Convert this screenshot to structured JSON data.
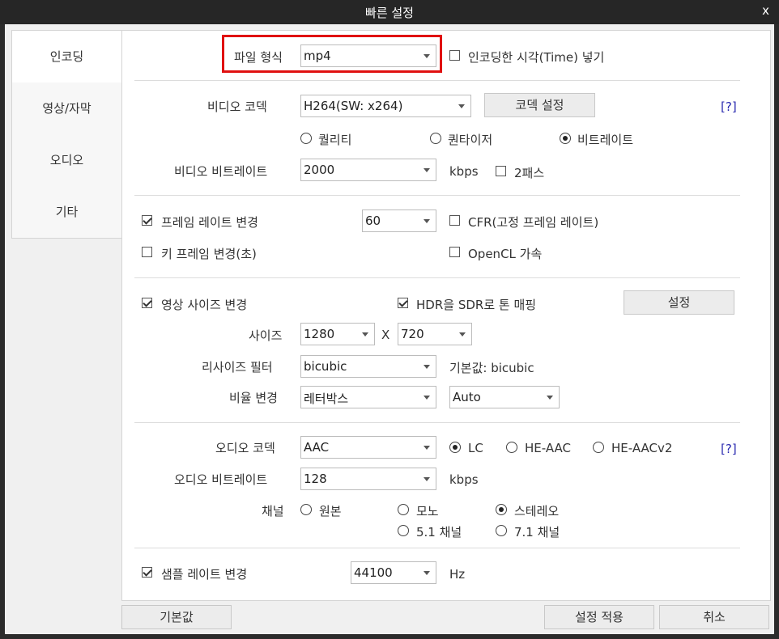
{
  "window": {
    "title": "빠른 설정",
    "close_label": "x"
  },
  "sidebar": {
    "items": [
      "인코딩",
      "영상/자막",
      "오디오",
      "기타"
    ]
  },
  "file_format": {
    "label": "파일 형식",
    "value": "mp4",
    "insert_time_label": "인코딩한 시각(Time) 넣기",
    "insert_time_checked": false
  },
  "video": {
    "codec_label": "비디오 코덱",
    "codec_value": "H264(SW: x264)",
    "codec_settings_button": "코덱 설정",
    "help_link": "[?]",
    "mode_options": [
      "퀄리티",
      "퀀타이저",
      "비트레이트"
    ],
    "mode_selected": "비트레이트",
    "bitrate_label": "비디오 비트레이트",
    "bitrate_value": "2000",
    "bitrate_unit": "kbps",
    "two_pass_label": "2패스",
    "two_pass_checked": false
  },
  "frame": {
    "change_fps_label": "프레임 레이트 변경",
    "change_fps_checked": true,
    "fps_value": "60",
    "cfr_label": "CFR(고정 프레임 레이트)",
    "cfr_checked": false,
    "keyframe_label": "키 프레임 변경(초)",
    "keyframe_checked": false,
    "opencl_label": "OpenCL 가속",
    "opencl_checked": false
  },
  "size": {
    "change_size_label": "영상 사이즈 변경",
    "change_size_checked": true,
    "hdr_label": "HDR을 SDR로 톤 매핑",
    "hdr_checked": true,
    "settings_button": "설정",
    "size_label": "사이즈",
    "width": "1280",
    "x_sep": "X",
    "height": "720",
    "resize_filter_label": "리사이즈 필터",
    "resize_filter_value": "bicubic",
    "resize_filter_default": "기본값: bicubic",
    "ratio_label": "비율 변경",
    "ratio_value": "레터박스",
    "ratio_mode_value": "Auto"
  },
  "audio": {
    "codec_label": "오디오 코덱",
    "codec_value": "AAC",
    "profile_options": [
      "LC",
      "HE-AAC",
      "HE-AACv2"
    ],
    "profile_selected": "LC",
    "help_link": "[?]",
    "bitrate_label": "오디오 비트레이트",
    "bitrate_value": "128",
    "bitrate_unit": "kbps",
    "channel_label": "채널",
    "channel_options": [
      "원본",
      "모노",
      "스테레오",
      "5.1 채널",
      "7.1 채널"
    ],
    "channel_selected": "스테레오",
    "sample_rate_label": "샘플 레이트 변경",
    "sample_rate_checked": true,
    "sample_rate_value": "44100",
    "sample_rate_unit": "Hz"
  },
  "footer": {
    "default_button": "기본값",
    "apply_button": "설정 적용",
    "cancel_button": "취소"
  },
  "colors": {
    "highlight_box": "#e01010",
    "link": "#2a2ab0",
    "titlebar": "#262626"
  }
}
